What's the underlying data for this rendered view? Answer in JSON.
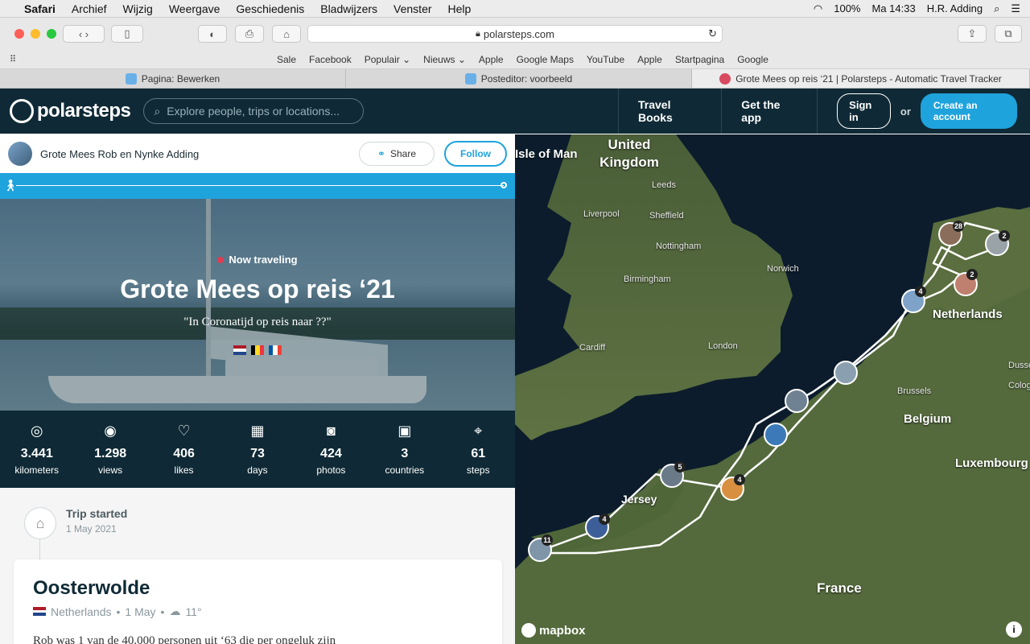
{
  "menubar": {
    "app": "Safari",
    "items": [
      "Archief",
      "Wijzig",
      "Weergave",
      "Geschiedenis",
      "Bladwijzers",
      "Venster",
      "Help"
    ],
    "battery": "100%",
    "clock": "Ma 14:33",
    "user": "H.R. Adding"
  },
  "browser": {
    "url": "polarsteps.com",
    "favorites": [
      "Sale",
      "Facebook",
      "Populair ⌄",
      "Nieuws ⌄",
      "Apple",
      "Google Maps",
      "YouTube",
      "Apple",
      "Startpagina",
      "Google"
    ],
    "tabs": [
      {
        "label": "Pagina: Bewerken"
      },
      {
        "label": "Posteditor: voorbeeld"
      },
      {
        "label": "Grote Mees op reis ‘21 | Polarsteps - Automatic Travel Tracker"
      }
    ]
  },
  "nav": {
    "logo": "polarsteps",
    "search_placeholder": "Explore people, trips or locations...",
    "travel_books": "Travel Books",
    "get_app": "Get the app",
    "sign_in": "Sign in",
    "or": "or",
    "create_account": "Create an account"
  },
  "trip": {
    "owner": "Grote Mees Rob en Nynke Adding",
    "share": "Share",
    "follow": "Follow",
    "status": "Now traveling",
    "title": "Grote Mees op reis ‘21",
    "subtitle": "\"In Coronatijd op reis naar ??\"",
    "stats": [
      {
        "icon": "compass-icon",
        "value": "3.441",
        "label": "kilometers"
      },
      {
        "icon": "eye-icon",
        "value": "1.298",
        "label": "views"
      },
      {
        "icon": "heart-icon",
        "value": "406",
        "label": "likes"
      },
      {
        "icon": "calendar-icon",
        "value": "73",
        "label": "days"
      },
      {
        "icon": "camera-icon",
        "value": "424",
        "label": "photos"
      },
      {
        "icon": "passport-icon",
        "value": "3",
        "label": "countries"
      },
      {
        "icon": "location-icon",
        "value": "61",
        "label": "steps"
      }
    ],
    "started_label": "Trip started",
    "started_date": "1 May 2021",
    "step": {
      "title": "Oosterwolde",
      "country": "Netherlands",
      "date": "1 May",
      "temp": "11°",
      "text": "Rob was 1 van de 40.000 personen uit ‘63 die per ongeluk zijn"
    }
  },
  "map": {
    "labels": {
      "uk": "United Kingdom",
      "isle": "Isle of Man",
      "leeds": "Leeds",
      "liverpool": "Liverpool",
      "sheffield": "Sheffield",
      "nottingham": "Nottingham",
      "norwich": "Norwich",
      "birmingham": "Birmingham",
      "cardiff": "Cardiff",
      "london": "London",
      "netherlands": "Netherlands",
      "dusseldorf": "Dusseld",
      "brussels": "Brussels",
      "belgium": "Belgium",
      "cologne": "Colog",
      "luxembourg": "Luxembourg",
      "jersey": "Jersey",
      "france": "France"
    },
    "clusters": [
      "28",
      "2",
      "2",
      "4",
      "5",
      "4",
      "4",
      "11"
    ],
    "attribution": "mapbox"
  }
}
